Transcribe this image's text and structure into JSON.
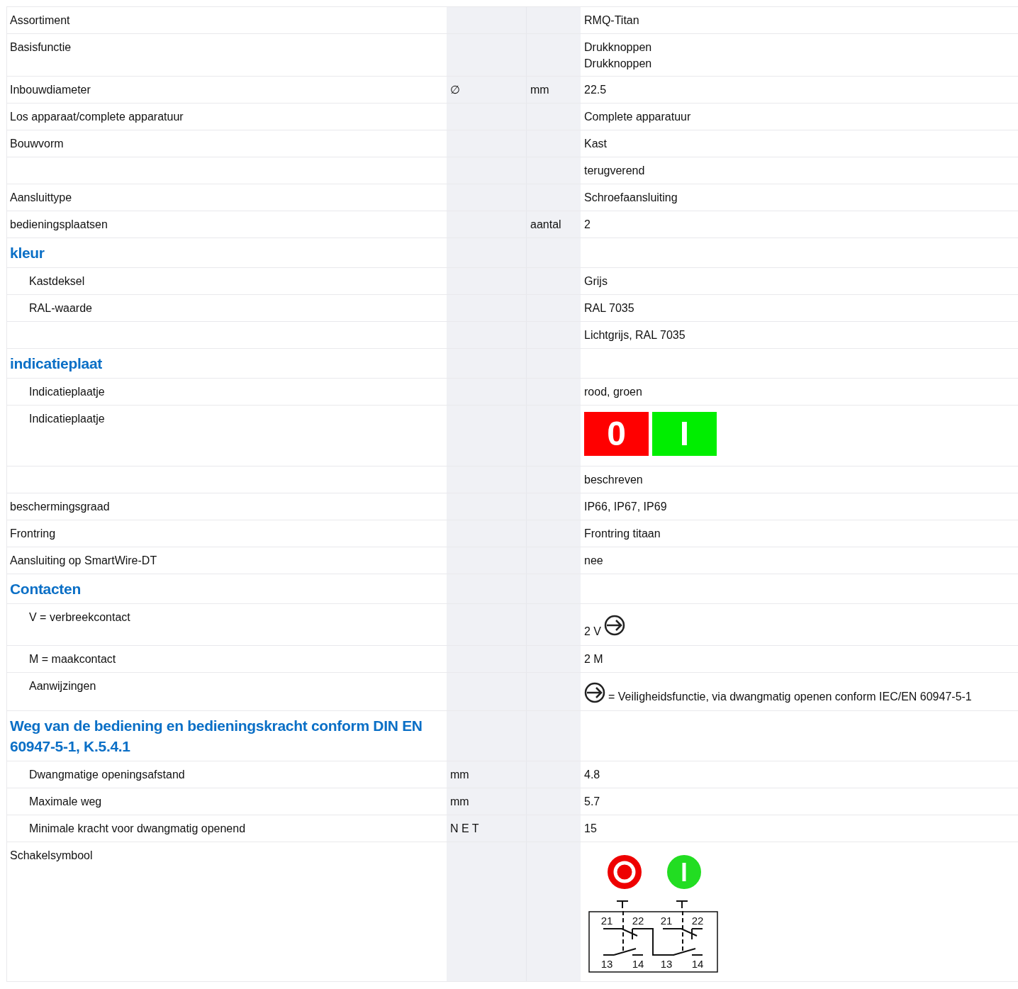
{
  "rows": [
    {
      "kind": "row",
      "label": "Assortiment",
      "value": {
        "kind": "text",
        "lines": [
          "RMQ-Titan"
        ]
      }
    },
    {
      "kind": "row",
      "label": "Basisfunctie",
      "value": {
        "kind": "text",
        "lines": [
          "Drukknoppen",
          "Drukknoppen"
        ]
      }
    },
    {
      "kind": "row",
      "label": "Inbouwdiameter",
      "symbol": "∅",
      "unit": "mm",
      "value": {
        "kind": "text",
        "lines": [
          "22.5"
        ]
      }
    },
    {
      "kind": "row",
      "label": "Los apparaat/complete apparatuur",
      "value": {
        "kind": "text",
        "lines": [
          "Complete apparatuur"
        ]
      }
    },
    {
      "kind": "row",
      "label": "Bouwvorm",
      "value": {
        "kind": "text",
        "lines": [
          "Kast"
        ]
      }
    },
    {
      "kind": "row",
      "value": {
        "kind": "text",
        "lines": [
          "terugverend"
        ]
      }
    },
    {
      "kind": "row",
      "label": "Aansluittype",
      "value": {
        "kind": "text",
        "lines": [
          "Schroefaansluiting"
        ]
      }
    },
    {
      "kind": "row",
      "label": "bedieningsplaatsen",
      "unit": "aantal",
      "value": {
        "kind": "text",
        "lines": [
          "2"
        ]
      }
    },
    {
      "kind": "section",
      "label": "kleur",
      "children": [
        {
          "kind": "row",
          "label": "Kastdeksel",
          "value": {
            "kind": "text",
            "lines": [
              "Grijs"
            ]
          }
        },
        {
          "kind": "row",
          "label": "RAL-waarde",
          "value": {
            "kind": "text",
            "lines": [
              "RAL 7035"
            ]
          }
        },
        {
          "kind": "row",
          "value": {
            "kind": "text",
            "lines": [
              "Lichtgrijs, RAL 7035"
            ]
          }
        }
      ]
    },
    {
      "kind": "section",
      "label": "indicatieplaat",
      "children": [
        {
          "kind": "row",
          "label": "Indicatieplaatje",
          "value": {
            "kind": "text",
            "lines": [
              "rood, groen"
            ]
          }
        },
        {
          "kind": "row",
          "label": "Indicatieplaatje",
          "value": {
            "kind": "plate",
            "segments": [
              {
                "text": "0",
                "color": "#ff0000"
              },
              {
                "text": "I",
                "color": "#00ee00"
              }
            ]
          }
        },
        {
          "kind": "row",
          "value": {
            "kind": "text",
            "lines": [
              "beschreven"
            ]
          }
        }
      ]
    },
    {
      "kind": "row",
      "label": "beschermingsgraad",
      "value": {
        "kind": "text",
        "lines": [
          "IP66, IP67, IP69"
        ]
      }
    },
    {
      "kind": "row",
      "label": "Frontring",
      "value": {
        "kind": "text",
        "lines": [
          "Frontring titaan"
        ]
      }
    },
    {
      "kind": "row",
      "label": "Aansluiting op SmartWire-DT",
      "value": {
        "kind": "text",
        "lines": [
          "nee"
        ]
      }
    },
    {
      "kind": "section",
      "label": "Contacten",
      "children": [
        {
          "kind": "row",
          "label": "V = verbreekcontact",
          "value": {
            "kind": "contact",
            "text": "2 V"
          }
        },
        {
          "kind": "row",
          "label": "M = maakcontact",
          "value": {
            "kind": "text",
            "lines": [
              "2 M"
            ]
          }
        },
        {
          "kind": "row",
          "label": "Aanwijzingen",
          "value": {
            "kind": "note",
            "text": "= Veiligheidsfunctie, via dwangmatig openen conform IEC/EN 60947-5-1"
          }
        }
      ]
    },
    {
      "kind": "section",
      "label": "Weg van de bediening en bedieningskracht conform DIN EN 60947-5-1, K.5.4.1",
      "children": [
        {
          "kind": "row",
          "label": "Dwangmatige openingsafstand",
          "symbol": "mm",
          "value": {
            "kind": "text",
            "lines": [
              "4.8"
            ]
          }
        },
        {
          "kind": "row",
          "label": "Maximale weg",
          "symbol": "mm",
          "value": {
            "kind": "text",
            "lines": [
              "5.7"
            ]
          }
        },
        {
          "kind": "row",
          "label": "Minimale kracht voor dwangmatig openend",
          "symbol": "N E T",
          "value": {
            "kind": "text",
            "lines": [
              "15"
            ]
          }
        }
      ]
    },
    {
      "kind": "row",
      "label": "Schakelsymbool",
      "value": {
        "kind": "schematic",
        "buttons": [
          {
            "kind": "off",
            "color": "#ee0000"
          },
          {
            "kind": "on",
            "color": "#22dd22"
          }
        ],
        "terminals": [
          "21",
          "22",
          "21",
          "22",
          "13",
          "14",
          "13",
          "14"
        ]
      }
    }
  ]
}
